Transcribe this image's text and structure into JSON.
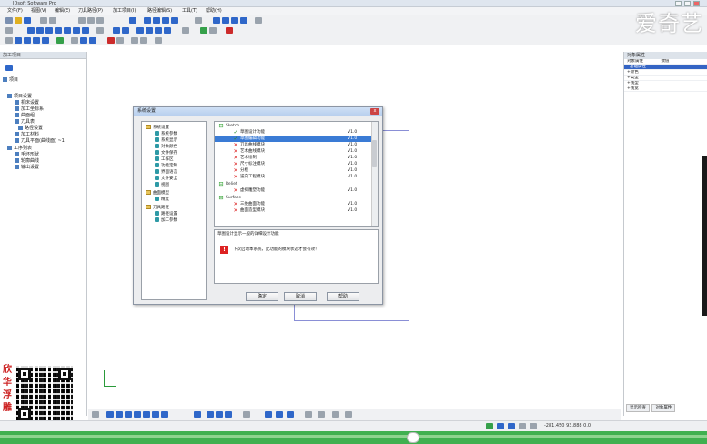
{
  "window": {
    "title": "IDsoft Software Pro"
  },
  "menu": [
    "文件(F)",
    "视图(V)",
    "编辑(E)",
    "刀具路径(P)",
    "加工项目(I)",
    "路径编辑(S)",
    "工具(T)",
    "帮助(H)"
  ],
  "watermark": "爱奇艺",
  "left_panel": {
    "header": "加工项目",
    "tree": [
      "项目",
      "项目设置",
      "机床设置",
      "加工坐标系",
      "曲面组",
      "刀具表",
      "路径设置",
      "加工材料",
      "刀具平面(曲线面) ~1",
      "工序列表",
      "毛坯形状",
      "轮廓曲线",
      "输出设置"
    ]
  },
  "promo_text": [
    "欣",
    "华",
    "浮",
    "雕"
  ],
  "right_panel": {
    "header": "对象属性",
    "column_headers": [
      "对象属性",
      "数值"
    ],
    "rows": [
      "- 基础属性",
      "+颜色",
      "+类型",
      "+线型",
      "+线宽"
    ],
    "tabs": [
      "显示检查",
      "对象属性"
    ]
  },
  "dialog": {
    "title": "系统设置",
    "close_label": "x",
    "tree": [
      {
        "label": "系统设置",
        "type": "folder"
      },
      {
        "label": "系统参数",
        "type": "leaf"
      },
      {
        "label": "系统显示",
        "type": "leaf"
      },
      {
        "label": "对象颜色",
        "type": "leaf"
      },
      {
        "label": "文件保存",
        "type": "leaf"
      },
      {
        "label": "工作区",
        "type": "leaf"
      },
      {
        "label": "功能定制",
        "type": "leaf"
      },
      {
        "label": "界面语言",
        "type": "leaf"
      },
      {
        "label": "文件安全",
        "type": "leaf"
      },
      {
        "label": "视图",
        "type": "leaf"
      },
      {
        "label": "曲面模型",
        "type": "folder"
      },
      {
        "label": "精度",
        "type": "leaf"
      },
      {
        "label": "刀具路径",
        "type": "folder"
      },
      {
        "label": "路径设置",
        "type": "leaf"
      },
      {
        "label": "加工参数",
        "type": "leaf"
      }
    ],
    "list": [
      {
        "group": "Sketch"
      },
      {
        "mark": "ok",
        "label": "草图设计功能",
        "ver": "V1.0"
      },
      {
        "mark": "ok",
        "label": "草图编辑功能",
        "ver": "V1.0",
        "selected": true
      },
      {
        "mark": "no",
        "label": "刀具曲线模块",
        "ver": "V1.0"
      },
      {
        "mark": "no",
        "label": "艺术曲线模块",
        "ver": "V1.0"
      },
      {
        "mark": "no",
        "label": "艺术绘制",
        "ver": "V1.0"
      },
      {
        "mark": "no",
        "label": "尺寸标注模块",
        "ver": "V1.0"
      },
      {
        "mark": "no",
        "label": "分模",
        "ver": "V1.0"
      },
      {
        "mark": "no",
        "label": "逆向工程模块",
        "ver": "V1.0"
      },
      {
        "group": "Relief"
      },
      {
        "mark": "no",
        "label": "虚拟雕塑功能",
        "ver": "V1.0"
      },
      {
        "group": "Surface"
      },
      {
        "mark": "no",
        "label": "三维曲面功能",
        "ver": "V1.0"
      },
      {
        "mark": "no",
        "label": "曲面造型模块",
        "ver": "V1.0"
      }
    ],
    "description": "草图设计显示一般的详细设计功能",
    "warning": "下次启动本系统，此功能的模块状态才会有效！",
    "buttons": {
      "ok": "确定",
      "cancel": "取消",
      "help": "帮助"
    }
  },
  "status": {
    "coords": "-281.450  93.888  0.0"
  }
}
